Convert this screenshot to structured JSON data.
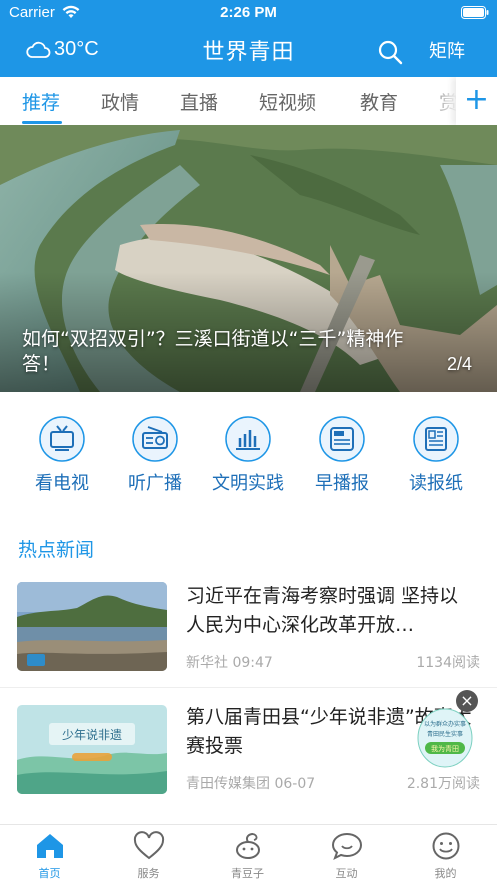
{
  "status_bar": {
    "carrier": "Carrier",
    "time": "2:26 PM"
  },
  "header": {
    "temperature": "30°C",
    "title": "世界青田",
    "right_link": "矩阵"
  },
  "tabs": [
    {
      "label": "推荐",
      "active": true
    },
    {
      "label": "政情",
      "active": false
    },
    {
      "label": "直播",
      "active": false
    },
    {
      "label": "短视频",
      "active": false
    },
    {
      "label": "教育",
      "active": false
    },
    {
      "label": "赏",
      "active": false
    }
  ],
  "tab_add": "+",
  "banner": {
    "caption": "如何“双招双引”？三溪口街道以“三千”精神作答！",
    "counter": "2/4"
  },
  "quick_links": [
    {
      "label": "看电视",
      "icon": "tv-icon"
    },
    {
      "label": "听广播",
      "icon": "radio-icon"
    },
    {
      "label": "文明实践",
      "icon": "bar-chart-icon"
    },
    {
      "label": "早播报",
      "icon": "news-icon"
    },
    {
      "label": "读报纸",
      "icon": "newspaper-icon"
    }
  ],
  "hot_news": {
    "title": "热点新闻",
    "items": [
      {
        "title": "习近平在青海考察时强调 坚持以人民为中心深化改革开放…",
        "source": "新华社",
        "time": "09:47",
        "reads": "1134阅读"
      },
      {
        "title": "第八届青田县“少年说非遗”故事大赛投票",
        "source": "青田传媒集团",
        "time": "06-07",
        "reads": "2.81万阅读",
        "thumb_text": "少年说非遗"
      }
    ]
  },
  "float_ad": {
    "line1": "以为群众办实事",
    "line2": "青田民生实事",
    "badge": "我为青田",
    "close": "×"
  },
  "bottom_nav": [
    {
      "label": "首页",
      "icon": "home-icon",
      "active": true
    },
    {
      "label": "服务",
      "icon": "heart-icon",
      "active": false
    },
    {
      "label": "青豆子",
      "icon": "bean-icon",
      "active": false
    },
    {
      "label": "互动",
      "icon": "chat-icon",
      "active": false
    },
    {
      "label": "我的",
      "icon": "smile-icon",
      "active": false
    }
  ],
  "colors": {
    "brand": "#1e96e6",
    "quick_label": "#1e6fb8",
    "muted": "#aaaaaa"
  }
}
